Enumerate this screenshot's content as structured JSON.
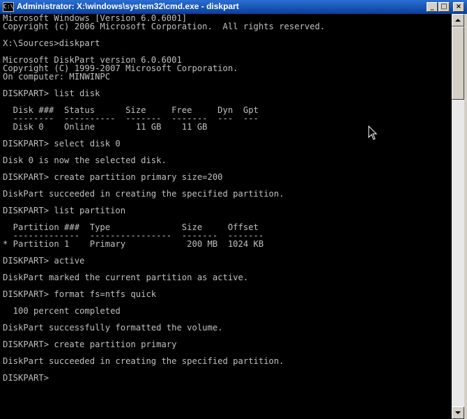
{
  "window": {
    "title": "Administrator: X:\\windows\\system32\\cmd.exe - diskpart",
    "icon_label": "C:\\",
    "controls": {
      "minimize": "_",
      "maximize": "□",
      "close": "×"
    }
  },
  "console": {
    "lines": [
      "Microsoft Windows [Version 6.0.6001]",
      "Copyright (c) 2006 Microsoft Corporation.  All rights reserved.",
      "",
      "X:\\Sources>diskpart",
      "",
      "Microsoft DiskPart version 6.0.6001",
      "Copyright (C) 1999-2007 Microsoft Corporation.",
      "On computer: MINWINPC",
      "",
      "DISKPART> list disk",
      "",
      "  Disk ###  Status      Size     Free     Dyn  Gpt",
      "  --------  ----------  -------  -------  ---  ---",
      "  Disk 0    Online        11 GB    11 GB",
      "",
      "DISKPART> select disk 0",
      "",
      "Disk 0 is now the selected disk.",
      "",
      "DISKPART> create partition primary size=200",
      "",
      "DiskPart succeeded in creating the specified partition.",
      "",
      "DISKPART> list partition",
      "",
      "  Partition ###  Type              Size     Offset",
      "  -------------  ----------------  -------  -------",
      "* Partition 1    Primary            200 MB  1024 KB",
      "",
      "DISKPART> active",
      "",
      "DiskPart marked the current partition as active.",
      "",
      "DISKPART> format fs=ntfs quick",
      "",
      "  100 percent completed",
      "",
      "DiskPart successfully formatted the volume.",
      "",
      "DISKPART> create partition primary",
      "",
      "DiskPart succeeded in creating the specified partition.",
      "",
      "DISKPART>"
    ]
  },
  "colors": {
    "console_bg": "#000000",
    "console_text": "#c0c0c0",
    "title_bar": "#0a3f99"
  }
}
